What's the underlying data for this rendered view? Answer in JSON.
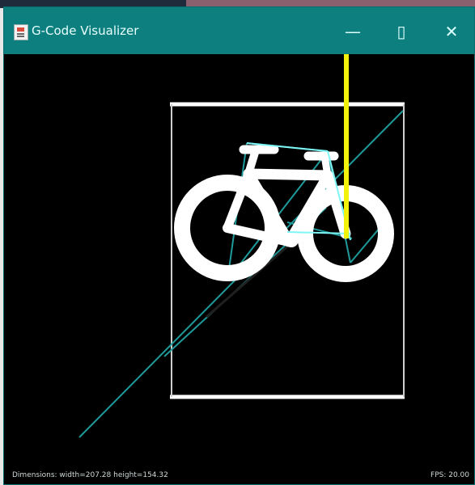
{
  "window": {
    "title": "G-Code Visualizer",
    "controls": {
      "minimize": "—",
      "maximize": "▯",
      "close": "✕"
    }
  },
  "status": {
    "dimensions": "Dimensions: width=207.28 height=154.32",
    "fps": "FPS: 20.00"
  },
  "colors": {
    "titlebar": "#0e7f7f",
    "canvas": "#000000",
    "toolpath": "#26c6c6",
    "drawing": "#ffffff",
    "tool": "#f2f20a"
  },
  "icons": {
    "app": "app-document-icon"
  }
}
